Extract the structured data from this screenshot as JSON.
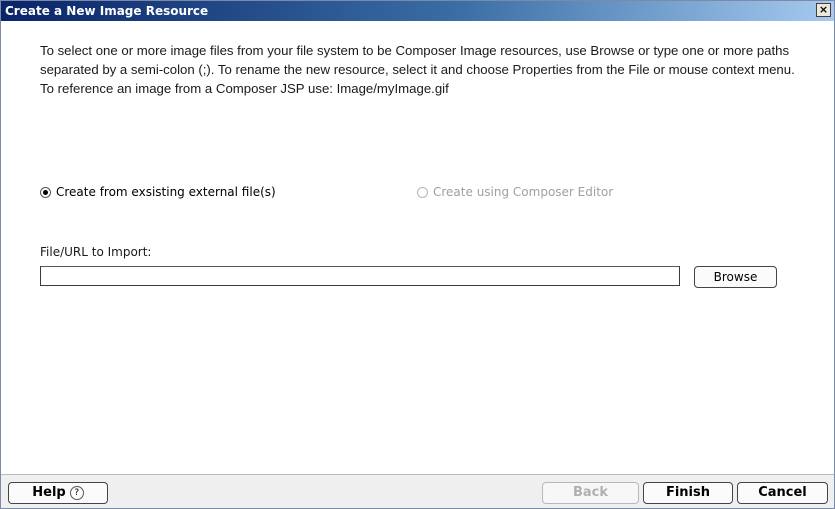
{
  "window": {
    "title": "Create a New Image Resource",
    "close_label": "×"
  },
  "description": "To select one or more image files from your file system to be Composer Image resources, use Browse or type one or more paths separated by a semi-colon (;).  To rename the new resource, select it and choose Properties from the File or mouse context menu. To reference an image from a Composer JSP use: Image/myImage.gif",
  "options": {
    "external": {
      "label": "Create from exsisting external file(s)",
      "selected": true
    },
    "editor": {
      "label": "Create using Composer Editor",
      "selected": false,
      "disabled": true
    }
  },
  "import": {
    "label": "File/URL to Import:",
    "value": "",
    "browse_label": "Browse"
  },
  "footer": {
    "help_label": "Help",
    "help_icon": "?",
    "back_label": "Back",
    "finish_label": "Finish",
    "cancel_label": "Cancel"
  },
  "colors": {
    "title_bar_start": "#0a246a",
    "title_bar_end": "#a6caf0",
    "disabled_text": "#a0a0a0"
  }
}
